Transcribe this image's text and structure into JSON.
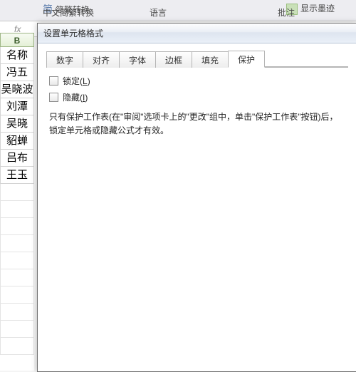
{
  "ribbon": {
    "simplified_traditional_cmd": "简繁转换",
    "group_language": "中文简繁转换",
    "group_language2": "语言",
    "group_comments": "批注",
    "track_cmd": "显示墨迹"
  },
  "fx_label": "fx",
  "sheet": {
    "column_header": "B",
    "rows": [
      "名称",
      "冯五",
      "吴晓波",
      "刘潭",
      "吴晓",
      "貂蝉",
      "吕布",
      "王玉"
    ]
  },
  "dialog": {
    "title": "设置单元格格式",
    "tabs": {
      "number": "数字",
      "alignment": "对齐",
      "font": "字体",
      "border": "边框",
      "fill": "填充",
      "protection": "保护"
    },
    "active_tab": "protection",
    "protection": {
      "locked_label": "锁定(",
      "locked_key": "L",
      "locked_tail": ")",
      "hidden_label": "隐藏(",
      "hidden_key": "I",
      "hidden_tail": ")",
      "locked_checked": false,
      "hidden_checked": false,
      "hint": "只有保护工作表(在\"审阅\"选项卡上的\"更改\"组中，单击\"保护工作表\"按钮)后，锁定单元格或隐藏公式才有效。"
    }
  }
}
